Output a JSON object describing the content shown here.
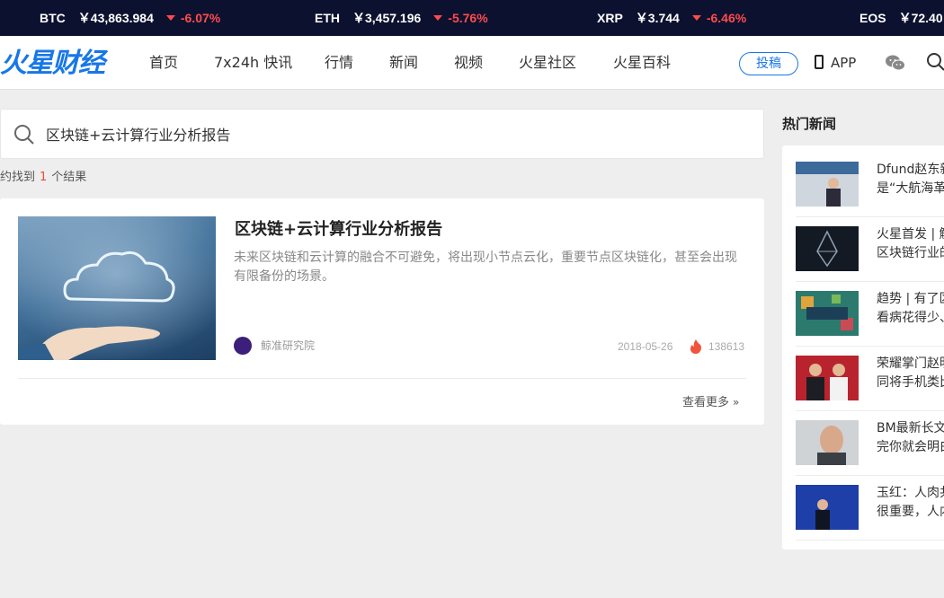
{
  "ticker": [
    {
      "symbol": "BTC",
      "price": "￥43,863.984",
      "change": "-6.07%"
    },
    {
      "symbol": "ETH",
      "price": "￥3,457.196",
      "change": "-5.76%"
    },
    {
      "symbol": "XRP",
      "price": "￥3.744",
      "change": "-6.46%"
    },
    {
      "symbol": "EOS",
      "price": "￥72.40",
      "change": ""
    }
  ],
  "logo": "火星财经",
  "nav": [
    "首页",
    "7x24h 快讯",
    "行情",
    "新闻",
    "视频",
    "火星社区",
    "火星百科"
  ],
  "header": {
    "submit_label": "投稿",
    "app_label": "APP",
    "icons": [
      "phone-icon",
      "wechat-icon",
      "search-icon"
    ]
  },
  "search": {
    "query": "区块链+云计算行业分析报告"
  },
  "results": {
    "prefix": "约找到",
    "count": "1",
    "suffix": "个结果"
  },
  "article": {
    "title": "区块链+云计算行业分析报告",
    "description": "未来区块链和云计算的融合不可避免，将出现小节点云化，重要节点区块链化，甚至会出现有限备份的场景。",
    "author": "鲸准研究院",
    "date": "2018-05-26",
    "views": "138613"
  },
  "more_label": "查看更多",
  "sidebar": {
    "title": "热门新闻",
    "items": [
      {
        "line1": "Dfund赵东新",
        "line2": "是“大航海革"
      },
      {
        "line1": "火星首发 | 解",
        "line2": "区块链行业的"
      },
      {
        "line1": "趋势 | 有了区",
        "line2": "看病花得少、"
      },
      {
        "line1": "荣耀掌门赵明",
        "line2": "同将手机类比"
      },
      {
        "line1": "BM最新长文",
        "line2": "完你就会明白"
      },
      {
        "line1": "玉红：人肉共",
        "line2": "很重要，人内"
      }
    ]
  },
  "colors": {
    "ticker_bg": "#0c1130",
    "brand": "#1777e8",
    "down": "#ff4b4b",
    "highlight": "#e94b3c"
  }
}
